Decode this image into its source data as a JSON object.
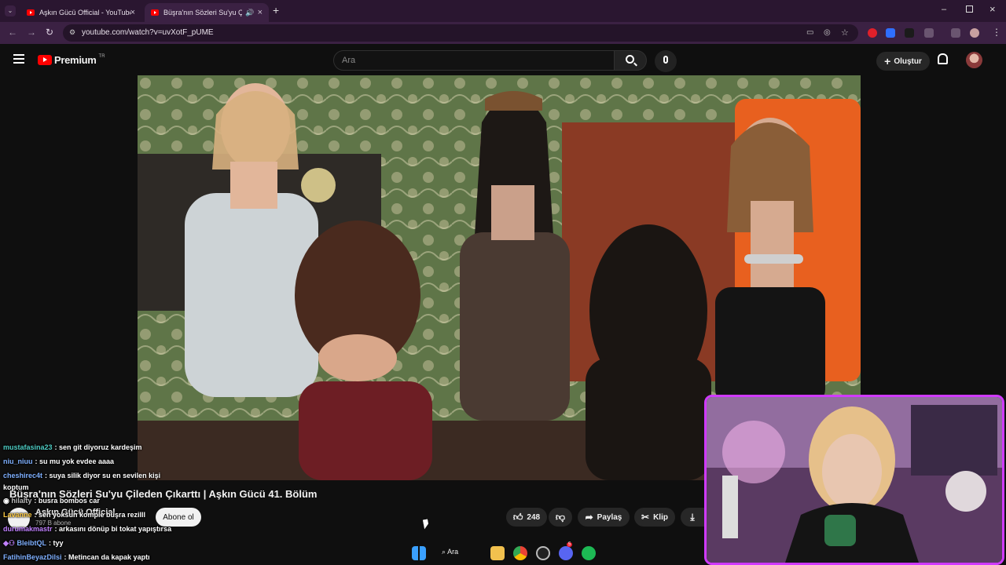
{
  "browser": {
    "tabs": [
      {
        "title": "Aşkın Gücü Official - YouTube"
      },
      {
        "title": "Büşra'nın Sözleri Su'yu Çileden Çıkarttı"
      }
    ],
    "url": "youtube.com/watch?v=uvXotF_pUME"
  },
  "youtube": {
    "logo_text": "Premium",
    "region": "TR",
    "search_placeholder": "Ara",
    "create_label": "Oluştur"
  },
  "video": {
    "title": "Büşra'nın Sözleri Su'yu Çileden Çıkarttı | Aşkın Gücü 41. Bölüm",
    "channel": "Aşkın Gücü Official",
    "subscribers": "797 B abone",
    "subscribe_label": "Abone ol",
    "likes": "248",
    "share_label": "Paylaş",
    "clip_label": "Klip"
  },
  "chat": [
    {
      "user": "mustafasina23",
      "text": "sen git diyoruz kardeşim",
      "color": "#4ecdc4"
    },
    {
      "user": "niu_niuu",
      "text": "su mu yok evdee aaaa",
      "color": "#7fb0ff"
    },
    {
      "user": "cheshirec4t",
      "text": "suya silik diyor su en sevilen kişi",
      "color": "#7fb0ff"
    },
    {
      "user": "",
      "text": "koptum",
      "color": "#ffffff"
    },
    {
      "user": "hilalty",
      "text": "busra bombos car",
      "color": "#b9b9b9"
    },
    {
      "user": "Lavanne",
      "text": "sen yoksun komple büşra rezilll",
      "color": "#ffcc44"
    },
    {
      "user": "durumakmastr",
      "text": "arkasını dönüp bi tokat yapıştırsa",
      "color": "#c080ff"
    },
    {
      "user": "BleibtQL",
      "text": "tyy",
      "color": "#7fb0ff"
    },
    {
      "user": "FatihinBeyazDilsi",
      "text": "Metincan da kapak yaptı",
      "color": "#7fb0ff"
    }
  ],
  "taskbar": {
    "search_label": "Ara",
    "discord_badge": "5"
  },
  "colors": {
    "youtube_red": "#ff0000",
    "cam_border": "#d03aff",
    "tab_bg": "#2a1630"
  }
}
